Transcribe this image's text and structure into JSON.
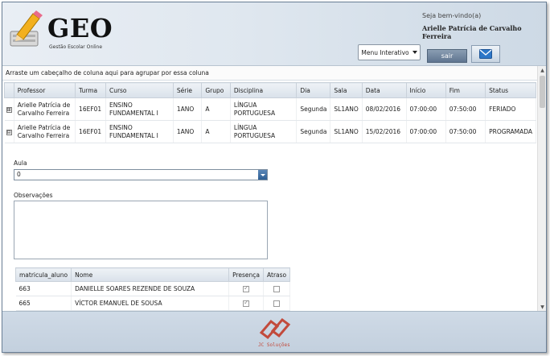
{
  "app": {
    "name": "GEO",
    "subtitle": "Gestão Escolar Online",
    "welcome_label": "Seja bem-vindo(a)",
    "user_name": "Arielle Patrícia de Carvalho Ferreira"
  },
  "toolbar": {
    "menu_label": "Menu Interativo",
    "logout_label": "sair",
    "mail_icon": "envelope-icon"
  },
  "grid": {
    "group_hint": "Arraste um cabeçalho de coluna aqui para agrupar por essa coluna",
    "columns": [
      "Professor",
      "Turma",
      "Curso",
      "Série",
      "Grupo",
      "Disciplina",
      "Dia",
      "Sala",
      "Data",
      "Início",
      "Fim",
      "Status"
    ],
    "rows": [
      {
        "expander": "⊞",
        "professor": "Arielle Patrícia de Carvalho Ferreira",
        "turma": "16EF01",
        "curso": "ENSINO FUNDAMENTAL I",
        "serie": "1ANO",
        "grupo": "A",
        "disciplina": "LÍNGUA PORTUGUESA",
        "dia": "Segunda",
        "sala": "SL1ANO",
        "data": "08/02/2016",
        "inicio": "07:00:00",
        "fim": "07:50:00",
        "status": "FERIADO"
      },
      {
        "expander": "⊟",
        "professor": "Arielle Patrícia de Carvalho Ferreira",
        "turma": "16EF01",
        "curso": "ENSINO FUNDAMENTAL I",
        "serie": "1ANO",
        "grupo": "A",
        "disciplina": "LÍNGUA PORTUGUESA",
        "dia": "Segunda",
        "sala": "SL1ANO",
        "data": "15/02/2016",
        "inicio": "07:00:00",
        "fim": "07:50:00",
        "status": "PROGRAMADA"
      }
    ]
  },
  "detail": {
    "aula_label": "Aula",
    "aula_value": "0",
    "observacoes_label": "Observações",
    "observacoes_value": ""
  },
  "alunos": {
    "columns": [
      "matricula_aluno",
      "Nome",
      "Presença",
      "Atraso"
    ],
    "rows": [
      {
        "matricula": "663",
        "nome": "DANIELLE SOARES REZENDE DE SOUZA",
        "presenca": true,
        "atraso": false
      },
      {
        "matricula": "665",
        "nome": "VÍCTOR EMANUEL DE SOUSA",
        "presenca": true,
        "atraso": false
      }
    ]
  },
  "footer": {
    "brand": "JC Soluções"
  },
  "colors": {
    "header_bg": "#dfe7ef",
    "accent_blue": "#2d5e93",
    "logo_red": "#c24a3c"
  }
}
